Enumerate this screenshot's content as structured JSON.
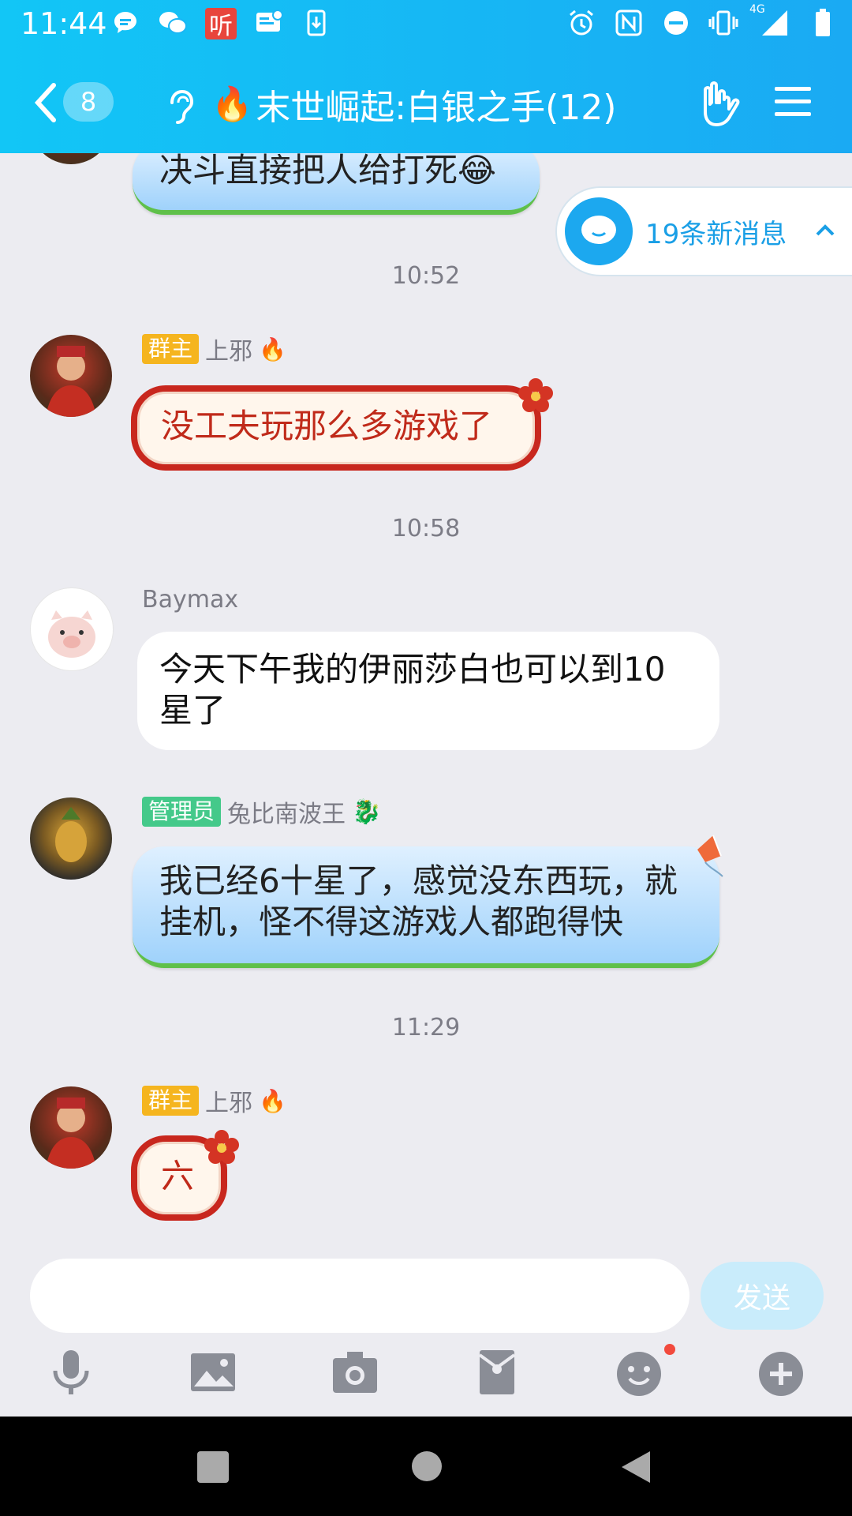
{
  "status_bar": {
    "time": "11:44",
    "left_icons": [
      "message-icon",
      "wechat-icon",
      "ting-app-icon",
      "notification-icon",
      "download-icon"
    ],
    "ting_label": "听",
    "right_icons": [
      "alarm-icon",
      "nfc-icon",
      "dnd-icon",
      "vibrate-icon",
      "signal-icon",
      "battery-icon"
    ],
    "network": "4G"
  },
  "header": {
    "unread_count": "8",
    "title_emoji": "🔥",
    "title": "末世崛起:白银之手(12)",
    "accent_color": "#1aaaf3"
  },
  "new_messages": {
    "label": "19条新消息"
  },
  "messages": [
    {
      "text": "决斗直接把人给打死😂"
    },
    {
      "time": "10:52"
    },
    {
      "badge": "群主",
      "name": "上邪",
      "flair": "🔥",
      "text": "没工夫玩那么多游戏了"
    },
    {
      "time": "10:58"
    },
    {
      "name": "Baymax",
      "text": "今天下午我的伊丽莎白也可以到10星了"
    },
    {
      "badge": "管理员",
      "name": "兔比南波王",
      "flair": "🐉",
      "text": "我已经6十星了，感觉没东西玩，就挂机，怪不得这游戏人都跑得快"
    },
    {
      "time": "11:29"
    },
    {
      "badge": "群主",
      "name": "上邪",
      "flair": "🔥",
      "text": "六"
    }
  ],
  "input": {
    "value": "",
    "send_label": "发送"
  },
  "toolbar": {
    "icons": [
      "microphone-icon",
      "image-icon",
      "camera-icon",
      "red-packet-icon",
      "emoji-icon",
      "plus-icon"
    ]
  },
  "navbar": {
    "icons": [
      "recent-apps-icon",
      "home-icon",
      "back-icon"
    ]
  }
}
